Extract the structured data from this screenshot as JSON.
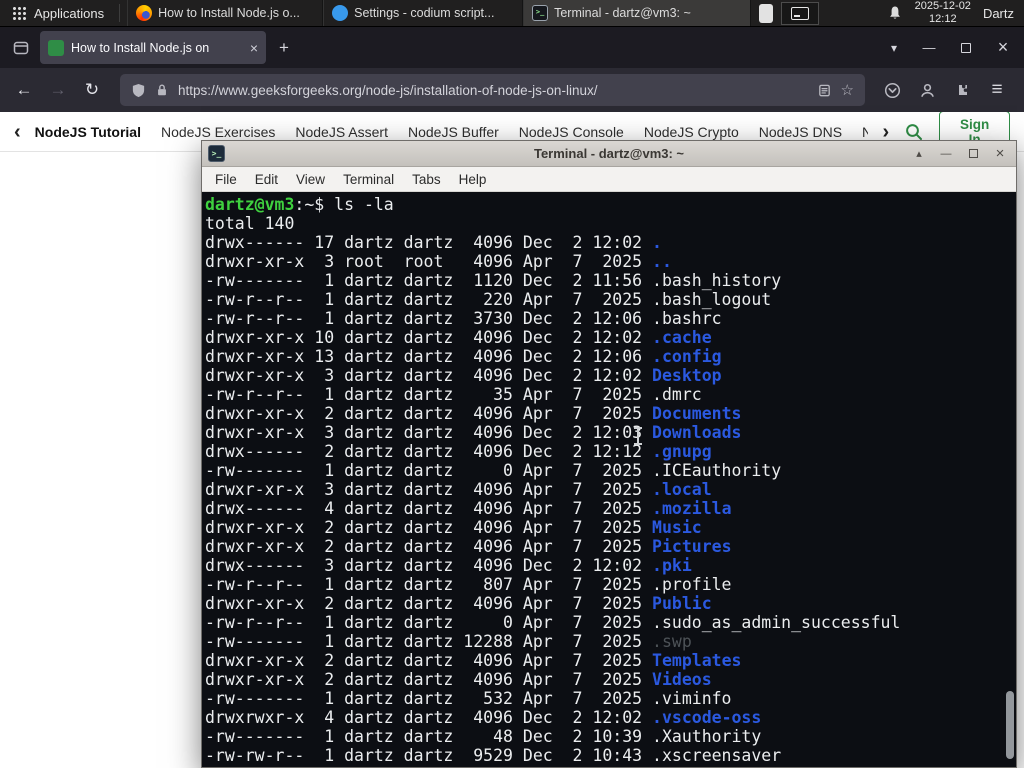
{
  "panel": {
    "applications_label": "Applications",
    "taskbar": [
      {
        "icon": "firefox",
        "label": "How to Install Node.js o...",
        "active": false
      },
      {
        "icon": "codium",
        "label": "Settings - codium script...",
        "active": false
      },
      {
        "icon": "terminal",
        "label": "Terminal - dartz@vm3: ~",
        "active": true
      }
    ],
    "clock_date": "2025-12-02",
    "clock_time": "12:12",
    "username": "Dartz"
  },
  "browser": {
    "tab_title": "How to Install Node.js on",
    "url": "https://www.geeksforgeeks.org/node-js/installation-of-node-js-on-linux/"
  },
  "site_nav": {
    "items": [
      {
        "label": "NodeJS Tutorial",
        "bold": true
      },
      {
        "label": "NodeJS Exercises"
      },
      {
        "label": "NodeJS Assert"
      },
      {
        "label": "NodeJS Buffer"
      },
      {
        "label": "NodeJS Console"
      },
      {
        "label": "NodeJS Crypto"
      },
      {
        "label": "NodeJS DNS"
      },
      {
        "label": "Node"
      }
    ],
    "sign_in_label": "Sign In",
    "accent": "#2f8d46"
  },
  "icons": {
    "close": "×",
    "close_big": "×",
    "plus": "+",
    "chevron_down": "▾",
    "minimize": "—",
    "back": "←",
    "forward": "→",
    "reload": "↻",
    "star": "☆",
    "hamburger": "≡",
    "chevron_left": "‹",
    "chevron_right": "›",
    "shade": "▴",
    "prompt": ">_"
  },
  "terminal": {
    "title": "Terminal - dartz@vm3: ~",
    "menu": [
      "File",
      "Edit",
      "View",
      "Terminal",
      "Tabs",
      "Help"
    ],
    "colors": {
      "bg": "#0c0e13",
      "fg": "#ebedef",
      "green": "#3fd13f",
      "blue": "#2b59e0",
      "dim": "#4d5257"
    },
    "lines": [
      {
        "segs": [
          {
            "t": "dartz@vm3",
            "c": "green"
          },
          {
            "t": ":~$ ls -la",
            "c": "fg"
          }
        ]
      },
      {
        "segs": [
          {
            "t": "total 140",
            "c": "fg"
          }
        ]
      },
      {
        "segs": [
          {
            "t": "drwx------ 17 dartz dartz  4096 Dec  2 12:02 ",
            "c": "fg"
          },
          {
            "t": ".",
            "c": "blue"
          }
        ]
      },
      {
        "segs": [
          {
            "t": "drwxr-xr-x  3 root  root   4096 Apr  7  2025 ",
            "c": "fg"
          },
          {
            "t": "..",
            "c": "blue"
          }
        ]
      },
      {
        "segs": [
          {
            "t": "-rw-------  1 dartz dartz  1120 Dec  2 11:56 .bash_history",
            "c": "fg"
          }
        ]
      },
      {
        "segs": [
          {
            "t": "-rw-r--r--  1 dartz dartz   220 Apr  7  2025 .bash_logout",
            "c": "fg"
          }
        ]
      },
      {
        "segs": [
          {
            "t": "-rw-r--r--  1 dartz dartz  3730 Dec  2 12:06 .bashrc",
            "c": "fg"
          }
        ]
      },
      {
        "segs": [
          {
            "t": "drwxr-xr-x 10 dartz dartz  4096 Dec  2 12:02 ",
            "c": "fg"
          },
          {
            "t": ".cache",
            "c": "blue"
          }
        ]
      },
      {
        "segs": [
          {
            "t": "drwxr-xr-x 13 dartz dartz  4096 Dec  2 12:06 ",
            "c": "fg"
          },
          {
            "t": ".config",
            "c": "blue"
          }
        ]
      },
      {
        "segs": [
          {
            "t": "drwxr-xr-x  3 dartz dartz  4096 Dec  2 12:02 ",
            "c": "fg"
          },
          {
            "t": "Desktop",
            "c": "blue"
          }
        ]
      },
      {
        "segs": [
          {
            "t": "-rw-r--r--  1 dartz dartz    35 Apr  7  2025 .dmrc",
            "c": "fg"
          }
        ]
      },
      {
        "segs": [
          {
            "t": "drwxr-xr-x  2 dartz dartz  4096 Apr  7  2025 ",
            "c": "fg"
          },
          {
            "t": "Documents",
            "c": "blue"
          }
        ]
      },
      {
        "segs": [
          {
            "t": "drwxr-xr-x  3 dartz dartz  4096 Dec  2 12:03 ",
            "c": "fg"
          },
          {
            "t": "Downloads",
            "c": "blue"
          }
        ]
      },
      {
        "segs": [
          {
            "t": "drwx------  2 dartz dartz  4096 Dec  2 12:12 ",
            "c": "fg"
          },
          {
            "t": ".gnupg",
            "c": "blue"
          }
        ]
      },
      {
        "segs": [
          {
            "t": "-rw-------  1 dartz dartz     0 Apr  7  2025 .ICEauthority",
            "c": "fg"
          }
        ]
      },
      {
        "segs": [
          {
            "t": "drwxr-xr-x  3 dartz dartz  4096 Apr  7  2025 ",
            "c": "fg"
          },
          {
            "t": ".local",
            "c": "blue"
          }
        ]
      },
      {
        "segs": [
          {
            "t": "drwx------  4 dartz dartz  4096 Apr  7  2025 ",
            "c": "fg"
          },
          {
            "t": ".mozilla",
            "c": "blue"
          }
        ]
      },
      {
        "segs": [
          {
            "t": "drwxr-xr-x  2 dartz dartz  4096 Apr  7  2025 ",
            "c": "fg"
          },
          {
            "t": "Music",
            "c": "blue"
          }
        ]
      },
      {
        "segs": [
          {
            "t": "drwxr-xr-x  2 dartz dartz  4096 Apr  7  2025 ",
            "c": "fg"
          },
          {
            "t": "Pictures",
            "c": "blue"
          }
        ]
      },
      {
        "segs": [
          {
            "t": "drwx------  3 dartz dartz  4096 Dec  2 12:02 ",
            "c": "fg"
          },
          {
            "t": ".pki",
            "c": "blue"
          }
        ]
      },
      {
        "segs": [
          {
            "t": "-rw-r--r--  1 dartz dartz   807 Apr  7  2025 .profile",
            "c": "fg"
          }
        ]
      },
      {
        "segs": [
          {
            "t": "drwxr-xr-x  2 dartz dartz  4096 Apr  7  2025 ",
            "c": "fg"
          },
          {
            "t": "Public",
            "c": "blue"
          }
        ]
      },
      {
        "segs": [
          {
            "t": "-rw-r--r--  1 dartz dartz     0 Apr  7  2025 .sudo_as_admin_successful",
            "c": "fg"
          }
        ]
      },
      {
        "segs": [
          {
            "t": "-rw-------  1 dartz dartz 12288 Apr  7  2025 ",
            "c": "fg"
          },
          {
            "t": ".swp",
            "c": "dim"
          }
        ]
      },
      {
        "segs": [
          {
            "t": "drwxr-xr-x  2 dartz dartz  4096 Apr  7  2025 ",
            "c": "fg"
          },
          {
            "t": "Templates",
            "c": "blue"
          }
        ]
      },
      {
        "segs": [
          {
            "t": "drwxr-xr-x  2 dartz dartz  4096 Apr  7  2025 ",
            "c": "fg"
          },
          {
            "t": "Videos",
            "c": "blue"
          }
        ]
      },
      {
        "segs": [
          {
            "t": "-rw-------  1 dartz dartz   532 Apr  7  2025 .viminfo",
            "c": "fg"
          }
        ]
      },
      {
        "segs": [
          {
            "t": "drwxrwxr-x  4 dartz dartz  4096 Dec  2 12:02 ",
            "c": "fg"
          },
          {
            "t": ".vscode-oss",
            "c": "blue"
          }
        ]
      },
      {
        "segs": [
          {
            "t": "-rw-------  1 dartz dartz    48 Dec  2 10:39 .Xauthority",
            "c": "fg"
          }
        ]
      },
      {
        "segs": [
          {
            "t": "-rw-rw-r--  1 dartz dartz  9529 Dec  2 10:43 .xscreensaver",
            "c": "fg"
          }
        ]
      }
    ]
  }
}
